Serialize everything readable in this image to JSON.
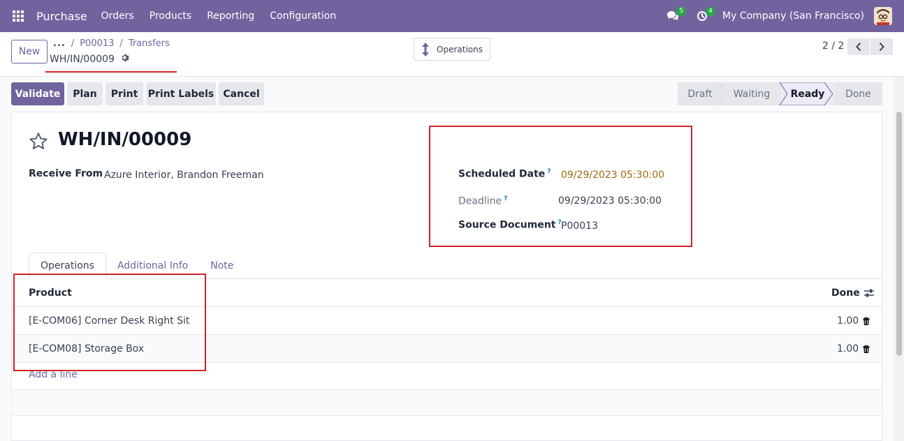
{
  "navbar": {
    "app_name": "Purchase",
    "menu": [
      "Orders",
      "Products",
      "Reporting",
      "Configuration"
    ],
    "messages_count": "5",
    "activities_count": "4",
    "company": "My Company (San Francisco)",
    "brand_color": "#71639e"
  },
  "control_panel": {
    "new_label": "New",
    "breadcrumb": [
      "...",
      "P00013",
      "Transfers"
    ],
    "record_name": "WH/IN/00009",
    "operations_label": "Operations",
    "pager": "2 / 2"
  },
  "actions": [
    "Validate",
    "Plan",
    "Print",
    "Print Labels",
    "Cancel"
  ],
  "status_stages": [
    "Draft",
    "Waiting",
    "Ready",
    "Done"
  ],
  "active_stage": "Ready",
  "form": {
    "title": "WH/IN/00009",
    "receive_from_label": "Receive From",
    "receive_from_value": "Azure Interior, Brandon Freeman",
    "scheduled_date_label": "Scheduled Date",
    "scheduled_date_value": "09/29/2023 05:30:00",
    "deadline_label": "Deadline",
    "deadline_value": "09/29/2023 05:30:00",
    "source_document_label": "Source Document",
    "source_document_value": "P00013",
    "help_mark": "?"
  },
  "tabs": [
    "Operations",
    "Additional Info",
    "Note"
  ],
  "table": {
    "headers": {
      "product": "Product",
      "done": "Done"
    },
    "rows": [
      {
        "product": "[E-COM06] Corner Desk Right Sit",
        "done": "1.00"
      },
      {
        "product": "[E-COM08] Storage Box",
        "done": "1.00"
      }
    ],
    "add_line": "Add a line"
  }
}
